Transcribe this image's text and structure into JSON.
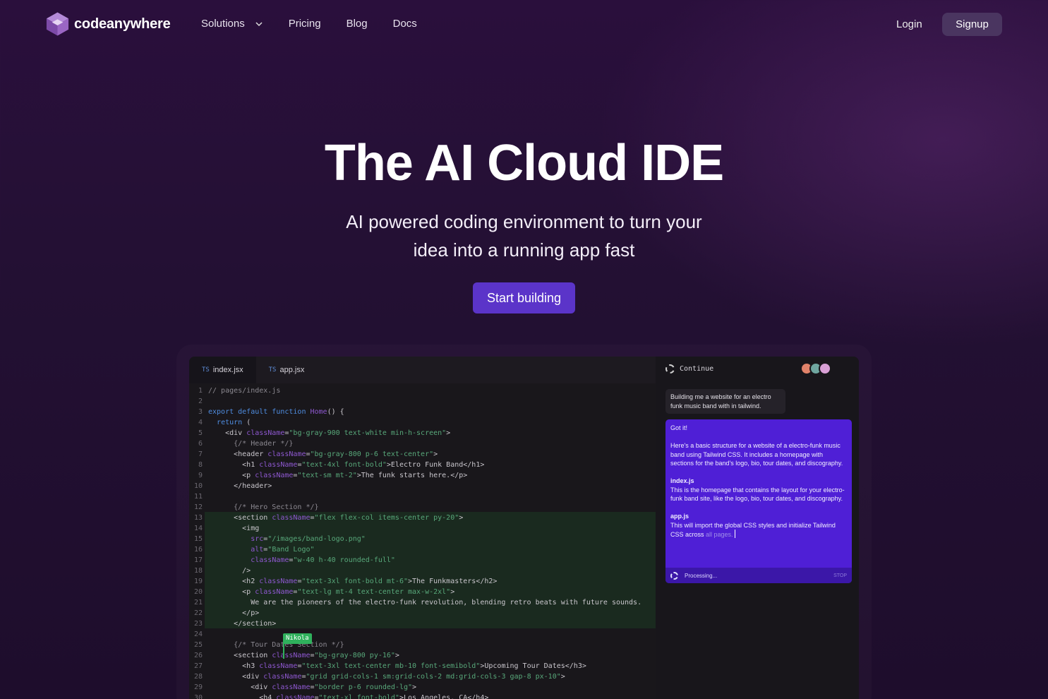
{
  "nav": {
    "logo_text": "codeanywhere",
    "links": [
      "Solutions",
      "Pricing",
      "Blog",
      "Docs"
    ],
    "login": "Login",
    "signup": "Signup"
  },
  "hero": {
    "title": "The AI Cloud IDE",
    "subtitle_line1": "AI powered coding environment to turn your",
    "subtitle_line2": "idea into a running app fast",
    "cta": "Start building"
  },
  "editor": {
    "tabs": [
      {
        "lang": "TS",
        "name": "index.jsx"
      },
      {
        "lang": "TS",
        "name": "app.jsx"
      }
    ],
    "collaborator": "Nikola",
    "lines": [
      {
        "n": "1",
        "parts": [
          [
            "c",
            "// pages/index.js"
          ]
        ]
      },
      {
        "n": "2",
        "parts": []
      },
      {
        "n": "3",
        "parts": [
          [
            "k",
            "export default function "
          ],
          [
            "a",
            "Home"
          ],
          [
            "",
            "() {"
          ]
        ]
      },
      {
        "n": "4",
        "parts": [
          [
            "",
            "  "
          ],
          [
            "k",
            "return"
          ],
          [
            "",
            " ("
          ]
        ]
      },
      {
        "n": "5",
        "parts": [
          [
            "",
            "    <div "
          ],
          [
            "a",
            "className"
          ],
          [
            "",
            "="
          ],
          [
            "s",
            "\"bg-gray-900 text-white min-h-screen\""
          ],
          [
            "",
            ">"
          ]
        ]
      },
      {
        "n": "6",
        "parts": [
          [
            "c",
            "      {/* Header */}"
          ]
        ]
      },
      {
        "n": "7",
        "parts": [
          [
            "",
            "      <header "
          ],
          [
            "a",
            "className"
          ],
          [
            "",
            "="
          ],
          [
            "s",
            "\"bg-gray-800 p-6 text-center\""
          ],
          [
            "",
            ">"
          ]
        ]
      },
      {
        "n": "8",
        "parts": [
          [
            "",
            "        <h1 "
          ],
          [
            "a",
            "className"
          ],
          [
            "",
            "="
          ],
          [
            "s",
            "\"text-4xl font-bold\""
          ],
          [
            "",
            ">Electro Funk Band</h1>"
          ]
        ]
      },
      {
        "n": "9",
        "parts": [
          [
            "",
            "        <p "
          ],
          [
            "a",
            "className"
          ],
          [
            "",
            "="
          ],
          [
            "s",
            "\"text-sm mt-2\""
          ],
          [
            "",
            ">The funk starts here.</p>"
          ]
        ]
      },
      {
        "n": "10",
        "parts": [
          [
            "",
            "      </header>"
          ]
        ]
      },
      {
        "n": "11",
        "parts": []
      },
      {
        "n": "12",
        "parts": [
          [
            "c",
            "      {/* Hero Section */}"
          ]
        ]
      },
      {
        "n": "13",
        "parts": [
          [
            "",
            "      <section "
          ],
          [
            "a",
            "className"
          ],
          [
            "",
            "="
          ],
          [
            "s",
            "\"flex flex-col items-center py-20\""
          ],
          [
            "",
            ">"
          ]
        ]
      },
      {
        "n": "14",
        "parts": [
          [
            "",
            "        <img"
          ]
        ]
      },
      {
        "n": "15",
        "parts": [
          [
            "",
            "          "
          ],
          [
            "a",
            "src"
          ],
          [
            "",
            "="
          ],
          [
            "s",
            "\"/images/band-logo.png\""
          ]
        ]
      },
      {
        "n": "16",
        "parts": [
          [
            "",
            "          "
          ],
          [
            "a",
            "alt"
          ],
          [
            "",
            "="
          ],
          [
            "s",
            "\"Band Logo\""
          ]
        ]
      },
      {
        "n": "17",
        "parts": [
          [
            "",
            "          "
          ],
          [
            "a",
            "className"
          ],
          [
            "",
            "="
          ],
          [
            "s",
            "\"w-40 h-40 rounded-full\""
          ]
        ]
      },
      {
        "n": "18",
        "parts": [
          [
            "",
            "        />"
          ]
        ]
      },
      {
        "n": "19",
        "parts": [
          [
            "",
            "        <h2 "
          ],
          [
            "a",
            "className"
          ],
          [
            "",
            "="
          ],
          [
            "s",
            "\"text-3xl font-bold mt-6\""
          ],
          [
            "",
            ">The Funkmasters</h2>"
          ]
        ]
      },
      {
        "n": "20",
        "parts": [
          [
            "",
            "        <p "
          ],
          [
            "a",
            "className"
          ],
          [
            "",
            "="
          ],
          [
            "s",
            "\"text-lg mt-4 text-center max-w-2xl\""
          ],
          [
            "",
            ">"
          ]
        ]
      },
      {
        "n": "21",
        "parts": [
          [
            "",
            "          We are the pioneers of the electro-funk revolution, blending retro beats with future sounds."
          ]
        ]
      },
      {
        "n": "22",
        "parts": [
          [
            "",
            "        </p>"
          ]
        ]
      },
      {
        "n": "23",
        "parts": [
          [
            "",
            "      </section>"
          ]
        ]
      },
      {
        "n": "24",
        "parts": []
      },
      {
        "n": "25",
        "parts": [
          [
            "c",
            "      {/* Tour Dates Section */}"
          ]
        ]
      },
      {
        "n": "26",
        "parts": [
          [
            "",
            "      <section "
          ],
          [
            "a",
            "className"
          ],
          [
            "",
            "="
          ],
          [
            "s",
            "\"bg-gray-800 py-16\""
          ],
          [
            "",
            ">"
          ]
        ]
      },
      {
        "n": "27",
        "parts": [
          [
            "",
            "        <h3 "
          ],
          [
            "a",
            "className"
          ],
          [
            "",
            "="
          ],
          [
            "s",
            "\"text-3xl text-center mb-10 font-semibold\""
          ],
          [
            "",
            ">Upcoming Tour Dates</h3>"
          ]
        ]
      },
      {
        "n": "28",
        "parts": [
          [
            "",
            "        <div "
          ],
          [
            "a",
            "className"
          ],
          [
            "",
            "="
          ],
          [
            "s",
            "\"grid grid-cols-1 sm:grid-cols-2 md:grid-cols-3 gap-8 px-10\""
          ],
          [
            "",
            ">"
          ]
        ]
      },
      {
        "n": "29",
        "parts": [
          [
            "",
            "          <div "
          ],
          [
            "a",
            "className"
          ],
          [
            "",
            "="
          ],
          [
            "s",
            "\"border p-6 rounded-lg\""
          ],
          [
            "",
            ">"
          ]
        ]
      },
      {
        "n": "30",
        "parts": [
          [
            "",
            "            <h4 "
          ],
          [
            "a",
            "className"
          ],
          [
            "",
            "="
          ],
          [
            "s",
            "\"text-xl font-bold\""
          ],
          [
            "",
            ">Los Angeles, CA</h4>"
          ]
        ]
      }
    ]
  },
  "chat": {
    "title": "Continue",
    "user_message": "Building me a website for an electro funk music band with in tailwind.",
    "ai_reply": {
      "intro": "Got it!",
      "summary": "Here's a basic structure for a website of a electro-funk music band using Tailwind CSS. It includes a homepage with sections for the band's logo, bio, tour dates, and discography.",
      "file1_name": "index.js",
      "file1_desc": "This is the homepage that contains the layout for your electro-funk band site, like the logo, bio, tour dates, and discography.",
      "file2_name": "app.js",
      "file2_desc": "This will import the global CSS styles and initialize Tailwind CSS across ",
      "file2_desc_fade": "all pages."
    },
    "status": "Processing...",
    "stop": "STOP",
    "avatar_colors": [
      "#e0826a",
      "#6fa6a0",
      "#d9a0d6"
    ]
  }
}
